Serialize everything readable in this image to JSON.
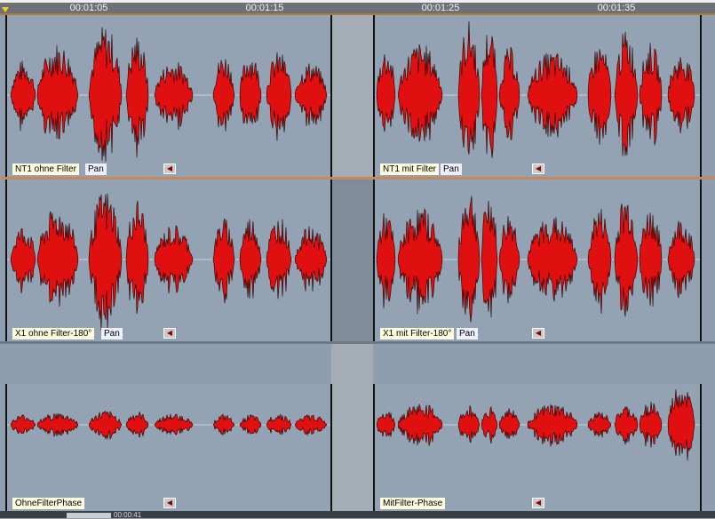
{
  "ruler": {
    "times": [
      "00:01:05",
      "00:01:15",
      "00:01:25",
      "00:01:35"
    ]
  },
  "tracks": [
    {
      "clips": [
        {
          "name": "NT1 ohne Filter",
          "pan": "Pan"
        },
        {
          "name": "NT1 mit Filter",
          "pan": "Pan"
        }
      ]
    },
    {
      "clips": [
        {
          "name": "X1 ohne Filter-180°",
          "pan": "Pan"
        },
        {
          "name": "X1 mit Filter-180°",
          "pan": "Pan"
        }
      ]
    },
    {
      "clips": [
        {
          "name": "OhneFilterPhase"
        },
        {
          "name": "MitFilter-Phase"
        }
      ]
    }
  ],
  "status": {
    "time": "00:00:41"
  },
  "colors": {
    "waveform": "#e01010",
    "background": "#8f9eae",
    "separator": "#c8895a"
  }
}
